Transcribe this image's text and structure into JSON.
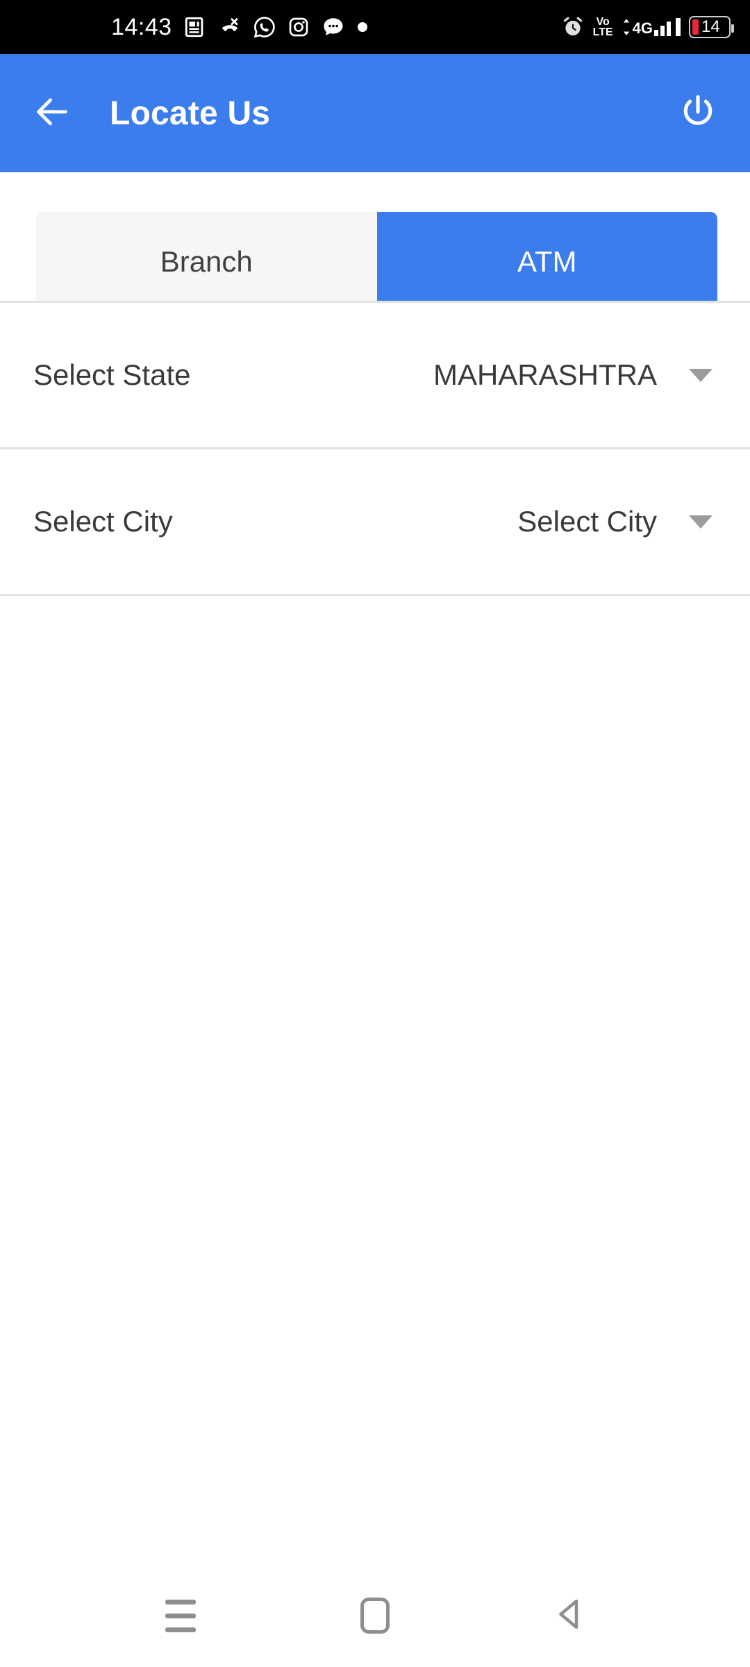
{
  "status_bar": {
    "time": "14:43",
    "left_icons": [
      "news-icon",
      "missed-call-icon",
      "whatsapp-icon",
      "instagram-icon",
      "message-icon",
      "dot-icon"
    ],
    "alarm_icon": "alarm-icon",
    "volte_line1": "Vo",
    "volte_line2": "LTE",
    "network_type": "4G",
    "battery_level": "14",
    "battery_color": "#e8283c"
  },
  "app_bar": {
    "back_icon": "back-arrow-icon",
    "title": "Locate Us",
    "power_icon": "power-icon",
    "background": "#3b7ded"
  },
  "tabs": {
    "items": [
      {
        "label": "Branch",
        "active": false
      },
      {
        "label": "ATM",
        "active": true
      }
    ],
    "active_color": "#3b7ded",
    "inactive_color": "#f6f6f6"
  },
  "form": {
    "rows": [
      {
        "label": "Select State",
        "value": "MAHARASHTRA",
        "caret_icon": "chevron-down-icon"
      },
      {
        "label": "Select City",
        "value": "Select City",
        "caret_icon": "chevron-down-icon"
      }
    ]
  },
  "nav_bar": {
    "recents_icon": "recents-menu-icon",
    "home_icon": "home-icon",
    "back_icon": "back-triangle-icon"
  }
}
